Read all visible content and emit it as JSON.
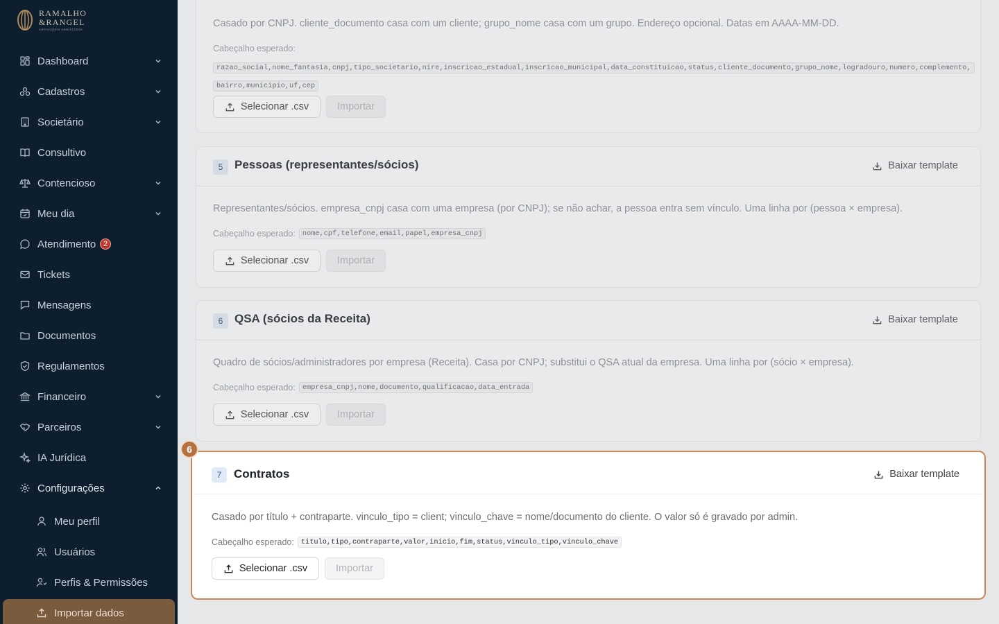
{
  "brand": {
    "line1": "RAMALHO",
    "line2": "&RANGEL",
    "line3": "ADVOGADOS ASSOCIADOS"
  },
  "sidebar": {
    "items": [
      {
        "label": "Dashboard",
        "icon": "dashboard-icon",
        "chevron": "down"
      },
      {
        "label": "Cadastros",
        "icon": "cadastros-icon",
        "chevron": "down"
      },
      {
        "label": "Societário",
        "icon": "building-icon",
        "chevron": "down"
      },
      {
        "label": "Consultivo",
        "icon": "book-icon"
      },
      {
        "label": "Contencioso",
        "icon": "scale-icon",
        "chevron": "down"
      },
      {
        "label": "Meu dia",
        "icon": "calendar-icon",
        "chevron": "down"
      },
      {
        "label": "Atendimento",
        "icon": "chat-icon",
        "badge": "2"
      },
      {
        "label": "Tickets",
        "icon": "ticket-icon"
      },
      {
        "label": "Mensagens",
        "icon": "message-icon"
      },
      {
        "label": "Documentos",
        "icon": "folder-icon"
      },
      {
        "label": "Regulamentos",
        "icon": "shield-icon"
      },
      {
        "label": "Financeiro",
        "icon": "bank-icon",
        "chevron": "down"
      },
      {
        "label": "Parceiros",
        "icon": "handshake-icon",
        "chevron": "down"
      },
      {
        "label": "IA Jurídica",
        "icon": "sparkle-icon"
      },
      {
        "label": "Configurações",
        "icon": "gear-icon",
        "chevron": "up"
      }
    ],
    "sub_items": [
      {
        "label": "Meu perfil",
        "icon": "user-icon"
      },
      {
        "label": "Usuários",
        "icon": "users-icon"
      },
      {
        "label": "Perfis & Permissões",
        "icon": "user-key-icon"
      },
      {
        "label": "Importar dados",
        "icon": "upload-icon",
        "active": true
      }
    ]
  },
  "cards": [
    {
      "description": "Casado por CNPJ. cliente_documento casa com um cliente; grupo_nome casa com um grupo. Endereço opcional. Datas em AAAA-MM-DD.",
      "header_label": "Cabeçalho esperado:",
      "header_line1": "razao_social,nome_fantasia,cnpj,tipo_societario,nire,inscricao_estadual,inscricao_municipal,data_constituicao,status,cliente_documento,grupo_nome,logradouro,numero,complemento,",
      "header_line2": "bairro,municipio,uf,cep",
      "select_label": "Selecionar .csv",
      "import_label": "Importar"
    },
    {
      "number": "5",
      "title": "Pessoas (representantes/sócios)",
      "template_label": "Baixar template",
      "description": "Representantes/sócios. empresa_cnpj casa com uma empresa (por CNPJ); se não achar, a pessoa entra sem vínculo. Uma linha por (pessoa × empresa).",
      "header_label": "Cabeçalho esperado:",
      "header_fields": "nome,cpf,telefone,email,papel,empresa_cnpj",
      "select_label": "Selecionar .csv",
      "import_label": "Importar"
    },
    {
      "number": "6",
      "title": "QSA (sócios da Receita)",
      "template_label": "Baixar template",
      "description": "Quadro de sócios/administradores por empresa (Receita). Casa por CNPJ; substitui o QSA atual da empresa. Uma linha por (sócio × empresa).",
      "header_label": "Cabeçalho esperado:",
      "header_fields": "empresa_cnpj,nome,documento,qualificacao,data_entrada",
      "select_label": "Selecionar .csv",
      "import_label": "Importar"
    },
    {
      "number": "7",
      "title": "Contratos",
      "template_label": "Baixar template",
      "description": "Casado por título + contraparte. vinculo_tipo = client; vinculo_chave = nome/documento do cliente. O valor só é gravado por admin.",
      "header_label": "Cabeçalho esperado:",
      "header_fields": "titulo,tipo,contraparte,valor,inicio,fim,status,vinculo_tipo,vinculo_chave",
      "select_label": "Selecionar .csv",
      "import_label": "Importar"
    }
  ],
  "tour_step": "6",
  "colors": {
    "sidebar_bg": "#0d1f2e",
    "accent": "#b5713f",
    "active_nav": "#7b5b3e"
  }
}
